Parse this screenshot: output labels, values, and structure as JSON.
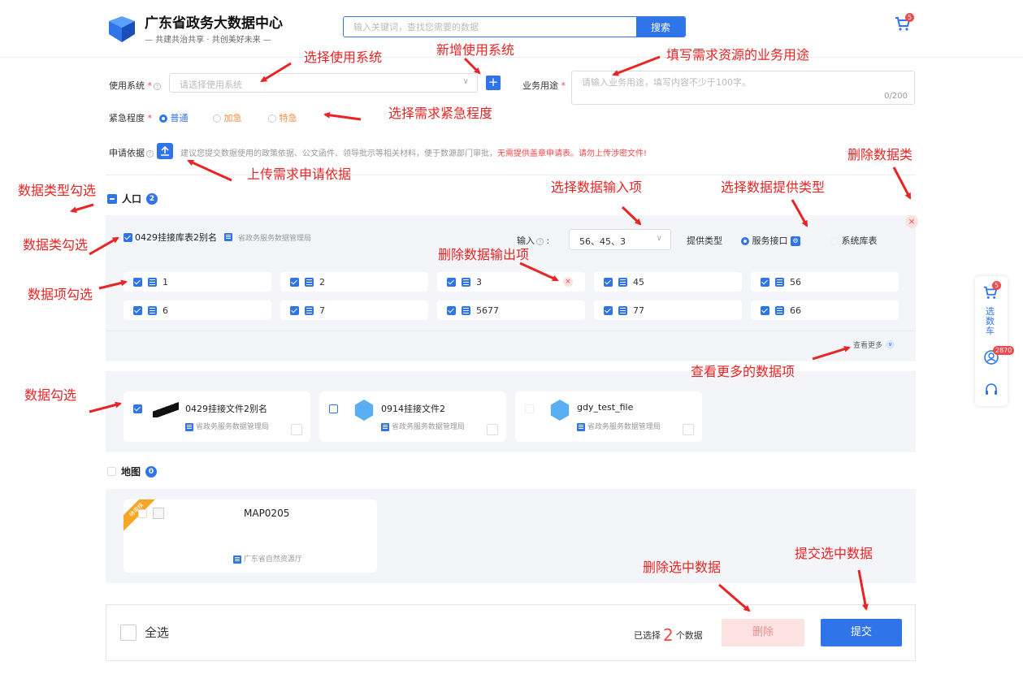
{
  "header": {
    "logo_title": "广东省政务大数据中心",
    "logo_subtitle": "— 共建共治共享 · 共创美好未来 —",
    "search_placeholder": "输入关键词，查找您需要的数据",
    "search_button": "搜索",
    "cart_count": "5"
  },
  "form": {
    "system_label": "使用系统",
    "system_placeholder": "请选择使用系统",
    "purpose_label": "业务用途",
    "purpose_placeholder": "请输入业务用途，填写内容不少于100字。",
    "purpose_counter": "0/200",
    "urgency_label": "紧急程度",
    "urgency_options": [
      "普通",
      "加急",
      "特急"
    ],
    "basis_label": "申请依据",
    "basis_hint": "建议您提交数据使用的政策依据、公文函件、领导批示等相关材料，便于数源部门审批，",
    "basis_hint_red": "无需提供盖章申请表。请勿上传涉密文件!"
  },
  "annotations": {
    "select_system": "选择使用系统",
    "add_system": "新增使用系统",
    "fill_purpose": "填写需求资源的业务用途",
    "select_urgency": "选择需求紧急程度",
    "upload_basis": "上传需求申请依据",
    "delete_category": "删除数据类",
    "type_check": "数据类型勾选",
    "select_input": "选择数据输入项",
    "select_provide": "选择数据提供类型",
    "class_check": "数据类勾选",
    "delete_output": "删除数据输出项",
    "item_check": "数据项勾选",
    "view_more": "查看更多的数据项",
    "data_check": "数据勾选",
    "delete_selected": "删除选中数据",
    "submit_selected": "提交选中数据"
  },
  "population": {
    "title": "人口",
    "count": "2",
    "table_name": "0429挂接库表2别名",
    "table_org": "省政务服务数据管理局",
    "input_label": "输入",
    "input_value": "56、45、3",
    "provide_label": "提供类型",
    "provide_options": [
      "服务接口",
      "系统库表"
    ],
    "items": [
      "1",
      "2",
      "3",
      "45",
      "56",
      "6",
      "7",
      "5677",
      "77",
      "66"
    ],
    "view_more": "查看更多",
    "files": [
      {
        "name": "0429挂接文件2别名",
        "org": "省政务服务数据管理局"
      },
      {
        "name": "0914挂接文件2",
        "org": "省政务服务数据管理局"
      },
      {
        "name": "gdy_test_file",
        "org": "省政务服务数据管理局"
      }
    ]
  },
  "map": {
    "title": "地图",
    "count": "0",
    "ribbon": "待审核",
    "item_name": "MAP0205",
    "item_org": "广东省自然资源厅"
  },
  "footer": {
    "select_all": "全选",
    "selected_prefix": "已选择",
    "selected_count": "2",
    "selected_suffix": "个数据",
    "delete": "删除",
    "submit": "提交"
  },
  "sidebar": {
    "cart_label": "选数车",
    "cart_count": "5",
    "user_count": "2870"
  },
  "colors": {
    "accent": "#2f74e8",
    "annotation": "#e82424"
  }
}
